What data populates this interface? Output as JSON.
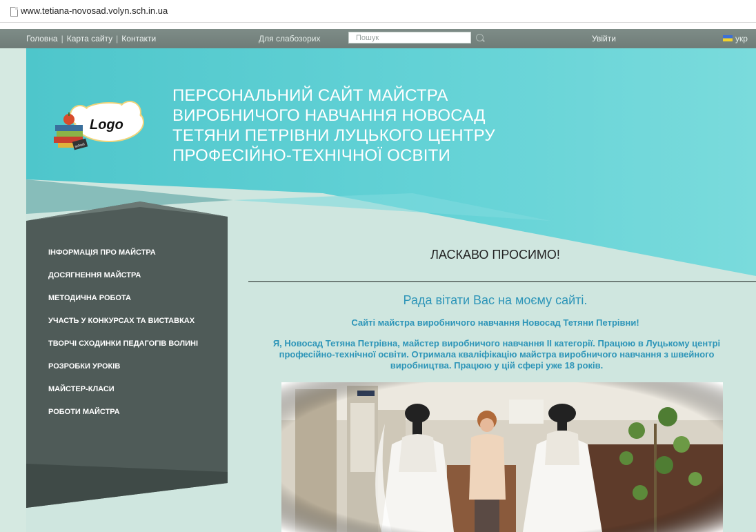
{
  "browser": {
    "url": "www.tetiana-novosad.volyn.sch.in.ua"
  },
  "topbar": {
    "links": [
      "Головна",
      "Карта сайту",
      "Контакти"
    ],
    "separator": "|",
    "low_vision": "Для слабозорих",
    "search_placeholder": "Пошук",
    "login": "Увійти",
    "language": "укр"
  },
  "header": {
    "logo_text": "Logo",
    "logo_badge": "school",
    "title_lines": [
      "ПЕРСОНАЛЬНИЙ САЙТ МАЙСТРА",
      "ВИРОБНИЧОГО НАВЧАННЯ НОВОСАД",
      "ТЕТЯНИ ПЕТРІВНИ ЛУЦЬКОГО ЦЕНТРУ",
      "ПРОФЕСІЙНО-ТЕХНІЧНОЇ ОСВІТИ"
    ]
  },
  "menu": {
    "items": [
      "ІНФОРМАЦІЯ ПРО МАЙСТРА",
      "ДОСЯГНЕННЯ МАЙСТРА",
      "МЕТОДИЧНА РОБОТА",
      "УЧАСТЬ У КОНКУРСАХ ТА ВИСТАВКАХ",
      "ТВОРЧІ СХОДИНКИ ПЕДАГОГІВ ВОЛИНІ",
      "РОЗРОБКИ УРОКІВ",
      "МАЙСТЕР-КЛАСИ",
      "РОБОТИ МАЙСТРА"
    ]
  },
  "content": {
    "welcome": "ЛАСКАВО ПРОСИМО!",
    "greeting": "Рада вітати Вас на моєму сайті.",
    "subtitle": "Сайті майстра виробничого навчання Новосад Тетяни Петрівни!",
    "intro": "Я, Новосад Тетяна Петрівна, майстер виробничого навчання ІІ категорії. Працюю в Луцькому центрі професійно-технічної освіти. Отримала кваліфікацію майстра виробничого навчання з швейного виробництва. Працюю у цій сфері уже 18 років."
  },
  "colors": {
    "topbar": "#74827e",
    "banner": "#5ccfd3",
    "menu_panel": "#4f5b58",
    "page_bg": "#cfe6df",
    "accent_text": "#2d95b8"
  }
}
